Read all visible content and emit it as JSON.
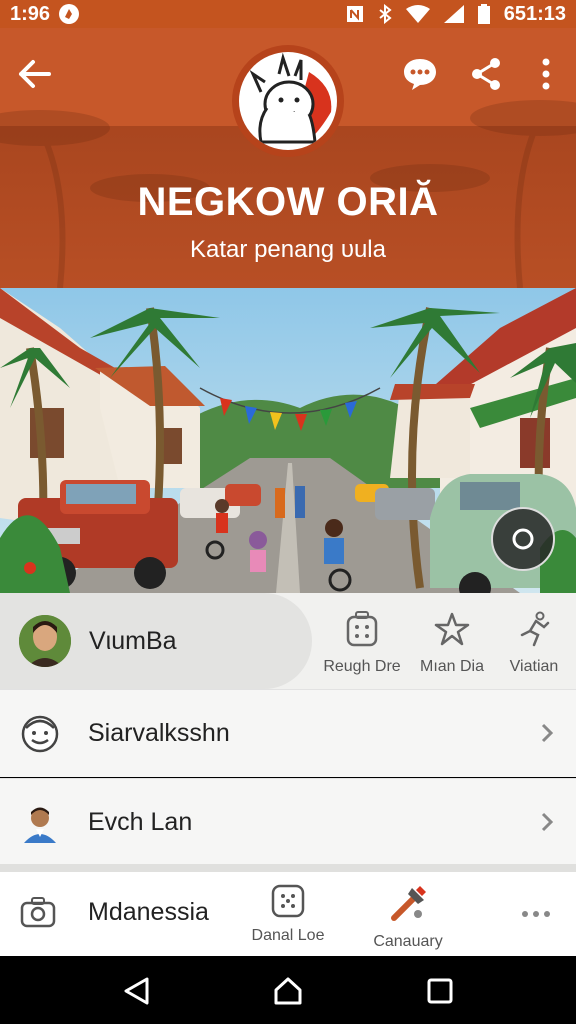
{
  "status_bar": {
    "time": "1:96",
    "right_text": "651:13"
  },
  "header": {
    "title": "NEGKOW ORIĂ",
    "subtitle": "Katar penang υula"
  },
  "profile": {
    "name": "VιumBa",
    "actions": [
      {
        "label": "Reugh Dre",
        "icon": "grid-icon"
      },
      {
        "label": "Mıan Dia",
        "icon": "star-icon"
      },
      {
        "label": "Viatian",
        "icon": "run-icon"
      }
    ]
  },
  "list": [
    {
      "label": "Siarvalksshn",
      "icon": "smiley-face-icon"
    },
    {
      "label": "Evch Lan",
      "icon": "person-avatar-icon"
    }
  ],
  "bottom_bar": {
    "left_label": "Mdanessia",
    "items": [
      {
        "label": "Danal Loe",
        "icon": "grid-icon"
      },
      {
        "label": "Canauary",
        "icon": "tools-icon"
      }
    ]
  },
  "colors": {
    "header": "#c7582a",
    "header_dark": "#a9461f",
    "background": "#f1f1ef"
  }
}
